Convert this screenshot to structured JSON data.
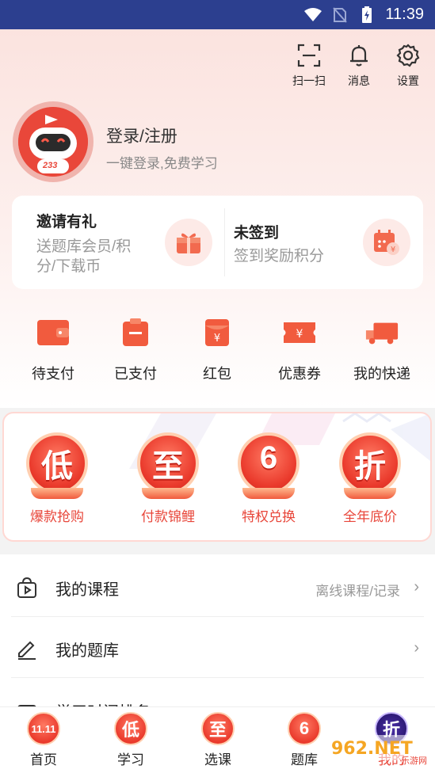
{
  "status_bar": {
    "time": "11:39"
  },
  "header": {
    "tools": [
      {
        "label": "扫一扫",
        "icon": "scan-icon"
      },
      {
        "label": "消息",
        "icon": "bell-icon"
      },
      {
        "label": "设置",
        "icon": "gear-icon"
      }
    ]
  },
  "profile": {
    "title": "登录/注册",
    "subtitle": "一键登录,免费学习",
    "avatar_badge": "233"
  },
  "cards": {
    "invite": {
      "title": "邀请有礼",
      "subtitle_line1": "送题库会员/积",
      "subtitle_line2": "分/下载币",
      "icon": "gift-icon"
    },
    "checkin": {
      "title": "未签到",
      "subtitle": "签到奖励积分",
      "icon": "calendar-icon"
    }
  },
  "shortcuts": [
    {
      "label": "待支付",
      "icon": "wallet-icon"
    },
    {
      "label": "已支付",
      "icon": "clipboard-icon"
    },
    {
      "label": "红包",
      "icon": "red-envelope-icon"
    },
    {
      "label": "优惠券",
      "icon": "coupon-icon"
    },
    {
      "label": "我的快递",
      "icon": "truck-icon"
    }
  ],
  "promo": {
    "items": [
      {
        "char": "低",
        "label": "爆款抢购"
      },
      {
        "char": "至",
        "label": "付款锦鲤"
      },
      {
        "char": "6",
        "label": "特权兑换"
      },
      {
        "char": "折",
        "label": "全年底价"
      }
    ]
  },
  "list": {
    "rows": [
      {
        "label": "我的课程",
        "right": "离线课程/记录",
        "icon": "play-bag-icon"
      },
      {
        "label": "我的题库",
        "right": "",
        "icon": "pencil-icon"
      },
      {
        "label": "学习时间排名",
        "right": "",
        "icon": "rank-icon"
      }
    ]
  },
  "tabbar": {
    "tabs": [
      {
        "char": "11.11",
        "label": "首页"
      },
      {
        "char": "低",
        "label": "学习"
      },
      {
        "char": "至",
        "label": "选课"
      },
      {
        "char": "6",
        "label": "题库"
      },
      {
        "char": "折",
        "label": "我的"
      }
    ]
  },
  "watermark": {
    "text": "962.NET",
    "subtext": "乐游网"
  },
  "colors": {
    "accent": "#e8463a",
    "status_bar": "#2c3f8f",
    "header_bg": "#fbe3df"
  }
}
